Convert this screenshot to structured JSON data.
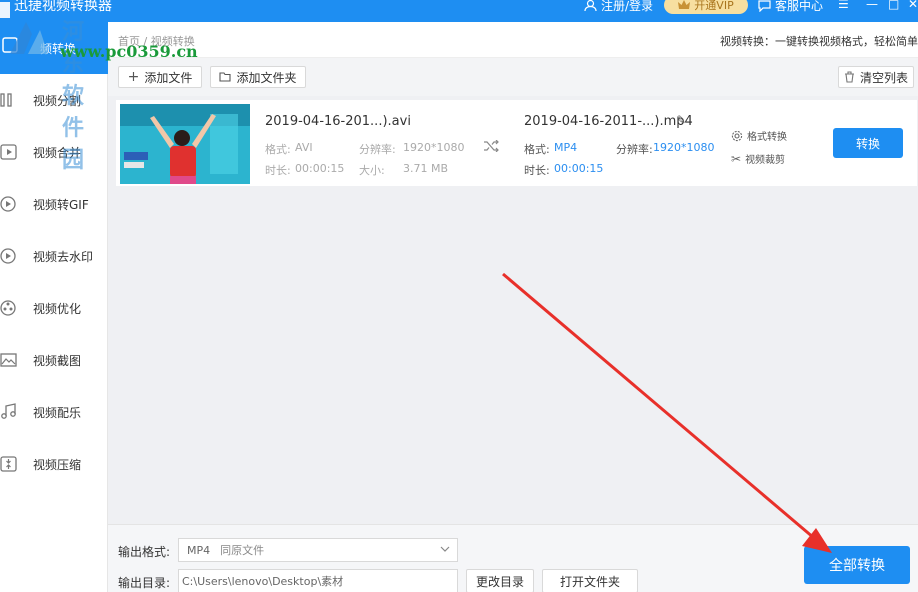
{
  "app": {
    "title": "迅捷视频转换器",
    "register_login": "注册/登录",
    "vip_label": "开通VIP",
    "service_label": "客服中心"
  },
  "watermark": {
    "site_name": "河东软件园",
    "url": "www.pc0359.cn"
  },
  "sidebar": {
    "active_label": "频转换",
    "items": [
      {
        "label": "视频分割",
        "icon": "split-icon"
      },
      {
        "label": "视频合并",
        "icon": "merge-icon"
      },
      {
        "label": "视频转GIF",
        "icon": "gif-icon"
      },
      {
        "label": "视频去水印",
        "icon": "watermark-remove-icon"
      },
      {
        "label": "视频优化",
        "icon": "optimize-icon"
      },
      {
        "label": "视频截图",
        "icon": "screenshot-icon"
      },
      {
        "label": "视频配乐",
        "icon": "music-icon"
      },
      {
        "label": "视频压缩",
        "icon": "compress-icon"
      }
    ]
  },
  "header": {
    "breadcrumb": "首页 / 视频转换",
    "description": "视频转换：一键转换视频格式，轻松简单"
  },
  "toolbar": {
    "add_file": "添加文件",
    "add_folder": "添加文件夹",
    "clear_list": "清空列表"
  },
  "file": {
    "source_name": "2019-04-16-201...).avi",
    "source_format_label": "格式:",
    "source_format": "AVI",
    "source_res_label": "分辨率:",
    "source_res": "1920*1080",
    "source_dur_label": "时长:",
    "source_dur": "00:00:15",
    "source_size_label": "大小:",
    "source_size": "3.71 MB",
    "target_name": "2019-04-16-2011-...).mp4",
    "target_format_label": "格式:",
    "target_format": "MP4",
    "target_res_label": "分辨率:",
    "target_res": "1920*1080",
    "target_dur_label": "时长:",
    "target_dur": "00:00:15",
    "op_format": "格式转换",
    "op_cut": "视频裁剪",
    "convert_label": "转换"
  },
  "bottom": {
    "format_label": "输出格式:",
    "format_value": "MP4",
    "format_quality": "同原文件",
    "dir_label": "输出目录:",
    "dir_value": "C:\\Users\\lenovo\\Desktop\\素材",
    "change_dir": "更改目录",
    "open_folder": "打开文件夹",
    "convert_all": "全部转换"
  },
  "colors": {
    "accent": "#1e8ef2",
    "annotation_arrow": "#e8302a"
  }
}
